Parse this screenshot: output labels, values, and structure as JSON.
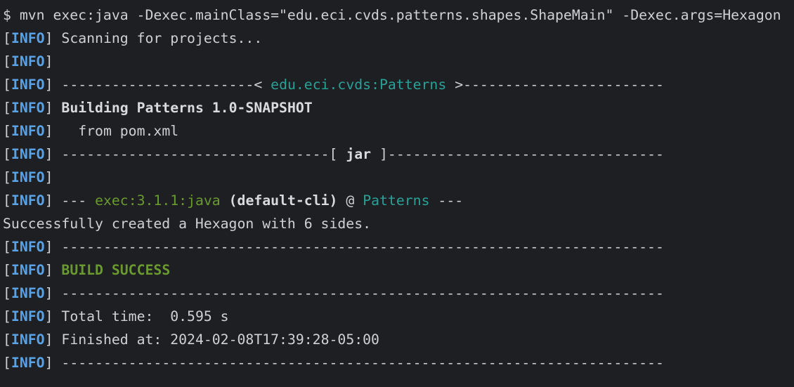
{
  "terminal": {
    "command_line": "$ mvn exec:java -Dexec.mainClass=\"edu.eci.cvds.patterns.shapes.ShapeMain\" -Dexec.args=Hexagon",
    "info_tag": "INFO",
    "bracket_open": "[",
    "bracket_close": "]",
    "lines": {
      "scanning": "Scanning for projects...",
      "header_left": "-----------------------<",
      "header_artifact": "edu.eci.cvds:Patterns",
      "header_right": ">------------------------",
      "building": "Building Patterns 1.0-SNAPSHOT",
      "from_pom": "  from pom.xml",
      "jar_left": "--------------------------------[",
      "jar_label": "jar",
      "jar_right": "]---------------------------------",
      "exec_prefix": "---",
      "exec_plugin": "exec:3.1.1:java",
      "exec_goal": "(default-cli)",
      "exec_at": "@",
      "exec_project": "Patterns",
      "exec_suffix": "---",
      "program_output": "Successfully created a Hexagon with 6 sides.",
      "separator": "------------------------------------------------------------------------",
      "build_success": "BUILD SUCCESS",
      "total_time": "Total time:  0.595 s",
      "finished_at": "Finished at: 2024-02-08T17:39:28-05:00"
    }
  }
}
